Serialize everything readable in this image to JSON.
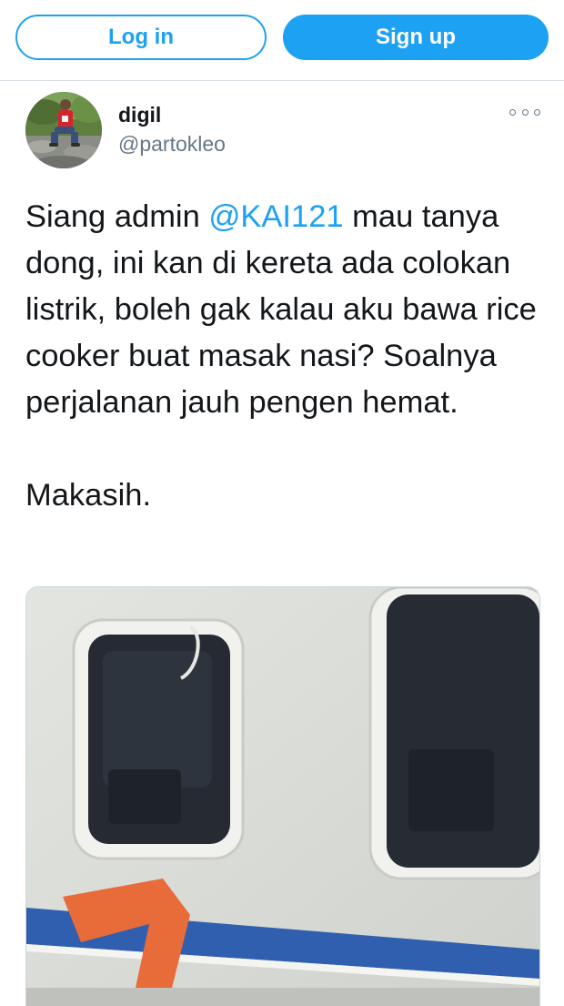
{
  "header": {
    "login_label": "Log in",
    "signup_label": "Sign up"
  },
  "tweet": {
    "display_name": "digil",
    "handle": "@partokleo",
    "text_before_mention": "Siang admin ",
    "mention": "@KAI121",
    "text_after_mention": " mau tanya dong, ini kan di kereta ada colokan listrik, boleh gak kalau aku bawa rice cooker buat masak nasi? Soalnya perjalanan jauh pengen hemat.",
    "text_closing": "Makasih.",
    "more_icon": "more-options-icon"
  },
  "colors": {
    "accent": "#1da1f2",
    "text": "#14171a",
    "secondary_text": "#657786",
    "divider": "#d6dde3"
  }
}
